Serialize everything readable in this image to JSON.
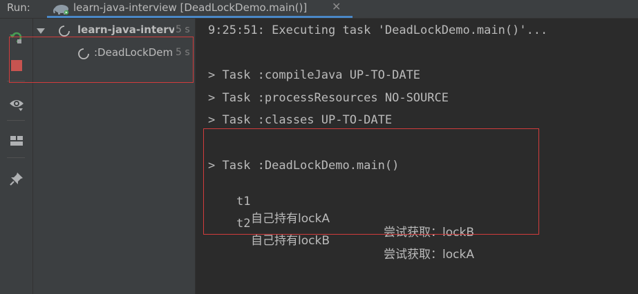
{
  "tabbar": {
    "run_label": "Run:",
    "tab_title": "learn-java-interview [DeadLockDemo.main()]",
    "close_glyph": "✕"
  },
  "toolbar": {
    "buttons": [
      "rerun-icon",
      "stop-icon",
      "eye-icon",
      "layout-icon",
      "pin-icon"
    ],
    "rerun_color": "#499c54",
    "stop_color": "#c75450"
  },
  "tree": {
    "root": {
      "label": "learn-java-interview",
      "time": "5 s"
    },
    "child": {
      "label": ":DeadLockDemo.main()",
      "time": "5 s"
    }
  },
  "console": {
    "lines": [
      "9:25:51: Executing task 'DeadLockDemo.main()'...",
      "",
      "> Task :compileJava UP-TO-DATE",
      "> Task :processResources NO-SOURCE",
      "> Task :classes UP-TO-DATE",
      "",
      "> Task :DeadLockDemo.main()"
    ],
    "output": [
      {
        "thread": "t1",
        "holds": "自己持有lockA",
        "tries": "尝试获取：lockB"
      },
      {
        "thread": "t2",
        "holds": "自己持有lockB",
        "tries": "尝试获取：lockA"
      }
    ]
  },
  "colors": {
    "background": "#2b2b2b",
    "panel": "#3c3f41",
    "text": "#bbbbbb",
    "highlight_box": "#d23c3c",
    "tab_underline": "#4a88c7"
  }
}
